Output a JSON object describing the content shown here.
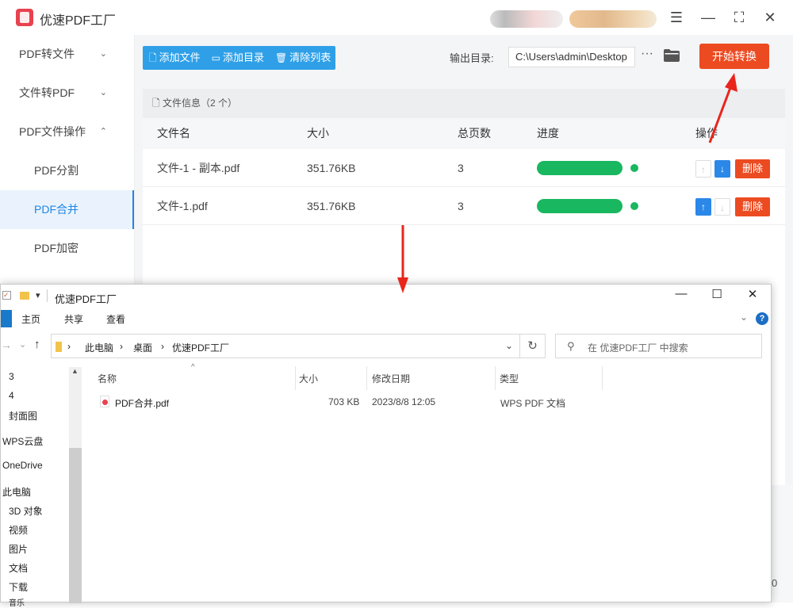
{
  "app": {
    "title": "优速PDF工厂",
    "sidebar": [
      {
        "label": "PDF转文件",
        "chevron": "⌄"
      },
      {
        "label": "文件转PDF",
        "chevron": "⌄"
      },
      {
        "label": "PDF文件操作",
        "chevron": "⌃"
      },
      {
        "label": "PDF分割"
      },
      {
        "label": "PDF合并",
        "active": true
      },
      {
        "label": "PDF加密"
      }
    ],
    "toolbar": {
      "add_file": "添加文件",
      "add_dir": "添加目录",
      "clear_list": "清除列表",
      "output_label": "输出目录:",
      "output_path": "C:\\Users\\admin\\Desktop",
      "more": "···",
      "start": "开始转换"
    },
    "file_info": "文件信息（2 个）",
    "columns": [
      "文件名",
      "大小",
      "总页数",
      "进度",
      "操作"
    ],
    "rows": [
      {
        "name": "文件-1 - 副本.pdf",
        "size": "351.76KB",
        "pages": "3",
        "progress": 1.0
      },
      {
        "name": "文件-1.pdf",
        "size": "351.76KB",
        "pages": "3",
        "progress": 1.0
      }
    ],
    "delete_label": "删除",
    "right_edge_digit": "0"
  },
  "explorer": {
    "title": "优速PDF工厂",
    "tabs": [
      "主页",
      "共享",
      "查看"
    ],
    "breadcrumb": [
      "此电脑",
      "桌面",
      "优速PDF工厂"
    ],
    "search_placeholder": "在 优速PDF工厂 中搜索",
    "nav": [
      "3",
      "4",
      "封面图",
      "WPS云盘",
      "OneDrive",
      "此电脑",
      "3D 对象",
      "视频",
      "图片",
      "文档",
      "下载",
      "音乐"
    ],
    "columns": [
      "名称",
      "大小",
      "修改日期",
      "类型"
    ],
    "files": [
      {
        "name": "PDF合并.pdf",
        "size": "703 KB",
        "modified": "2023/8/8 12:05",
        "type": "WPS PDF 文档"
      }
    ]
  },
  "colors": {
    "accent_blue": "#2fa0e8",
    "start_orange": "#ec4b22",
    "progress_green": "#19b75f",
    "annotation_red": "#e8261c"
  }
}
